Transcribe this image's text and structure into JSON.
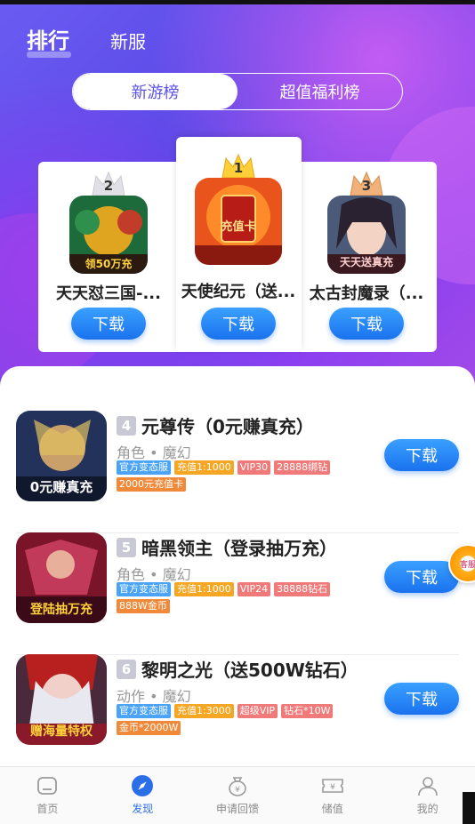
{
  "header": {
    "tab_rank": "排行",
    "tab_new": "新服"
  },
  "segment": {
    "left": "新游榜",
    "right": "超值福利榜"
  },
  "podium": [
    {
      "rank": "2",
      "name": "天天怼三国-...",
      "download": "下载",
      "icon_caption": "领50万充"
    },
    {
      "rank": "1",
      "name": "天使纪元（送...",
      "download": "下载",
      "icon_caption": "充值卡"
    },
    {
      "rank": "3",
      "name": "太古封魔录（...",
      "download": "下载",
      "icon_caption": "天天送真充"
    }
  ],
  "list": [
    {
      "rank": "4",
      "title": "元尊传（0元赚真充）",
      "category": "角色 • 魔幻",
      "tags": [
        "官方变态服",
        "充值1:1000",
        "VIP30",
        "28888绑钻",
        "2000元充值卡"
      ],
      "download": "下载",
      "icon_caption": "0元赚真充"
    },
    {
      "rank": "5",
      "title": "暗黑领主（登录抽万充）",
      "category": "角色 • 魔幻",
      "tags": [
        "官方变态服",
        "充值1:1000",
        "VIP24",
        "38888钻石",
        "888W金币"
      ],
      "download": "下载",
      "icon_caption": "登陆抽万充"
    },
    {
      "rank": "6",
      "title": "黎明之光（送500W钻石）",
      "category": "动作 • 魔幻",
      "tags": [
        "官方变态服",
        "充值1:3000",
        "超级VIP",
        "钻石*10W",
        "金币*2000W"
      ],
      "download": "下载",
      "icon_caption": "赠海量特权"
    }
  ],
  "floater": {
    "label": "客服"
  },
  "tabbar": [
    {
      "label": "首页",
      "icon": "home-icon"
    },
    {
      "label": "发现",
      "icon": "compass-icon"
    },
    {
      "label": "申请回馈",
      "icon": "money-bag-icon"
    },
    {
      "label": "储值",
      "icon": "ticket-icon"
    },
    {
      "label": "我的",
      "icon": "user-icon"
    }
  ],
  "colors": {
    "accent": "#2b6fe8",
    "hero": "#6a5cf2",
    "tag_blue": "#4aa3f5",
    "tag_orange": "#f59a23",
    "tag_pink": "#f07a7a"
  }
}
